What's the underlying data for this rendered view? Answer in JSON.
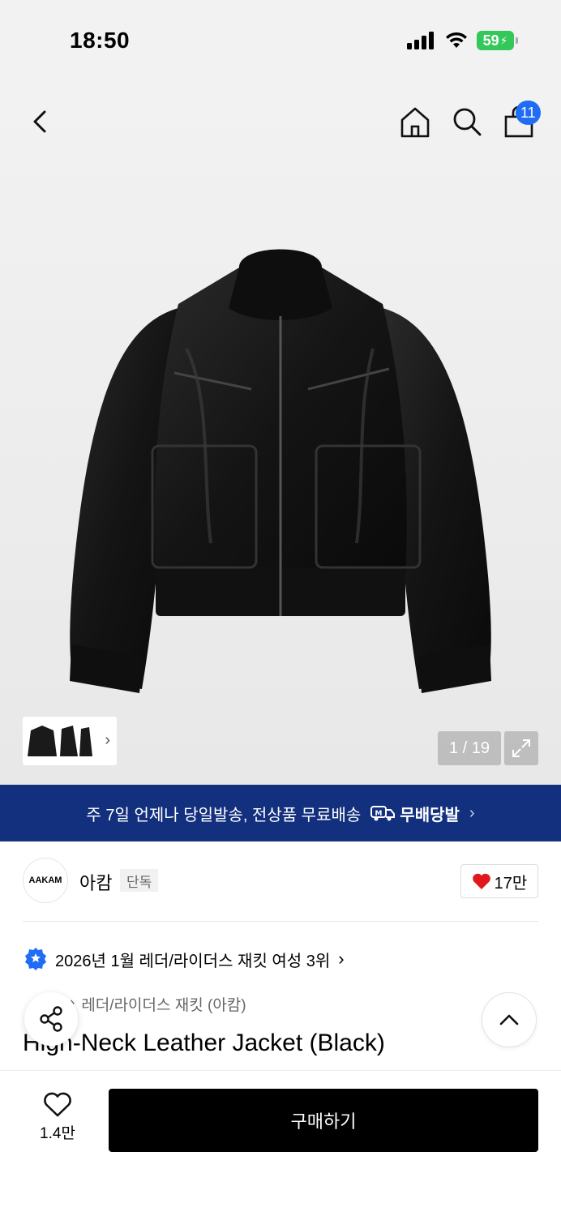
{
  "status_bar": {
    "time": "18:50",
    "battery": "59"
  },
  "header": {
    "cart_count": "11"
  },
  "gallery": {
    "counter": "1 / 19"
  },
  "promo": {
    "text": "주 7일 언제나 당일발송, 전상품 무료배송",
    "badge": "무배당발"
  },
  "brand": {
    "logo_text": "AAKAM",
    "name": "아캄",
    "tag": "단독",
    "likes": "17만"
  },
  "ranking": {
    "text": "2026년 1월 레더/라이더스 재킷 여성 3위"
  },
  "breadcrumb": {
    "category": "레더/라이더스 재킷 (아캄)"
  },
  "product": {
    "title": "High-Neck Leather Jacket (Black)",
    "wish_count": "1.4만"
  },
  "actions": {
    "buy_label": "구매하기"
  },
  "colors": {
    "promo_bg": "#13307f",
    "badge_blue": "#1f6cf5",
    "heart_red": "#e0191f",
    "battery_green": "#34c759"
  }
}
